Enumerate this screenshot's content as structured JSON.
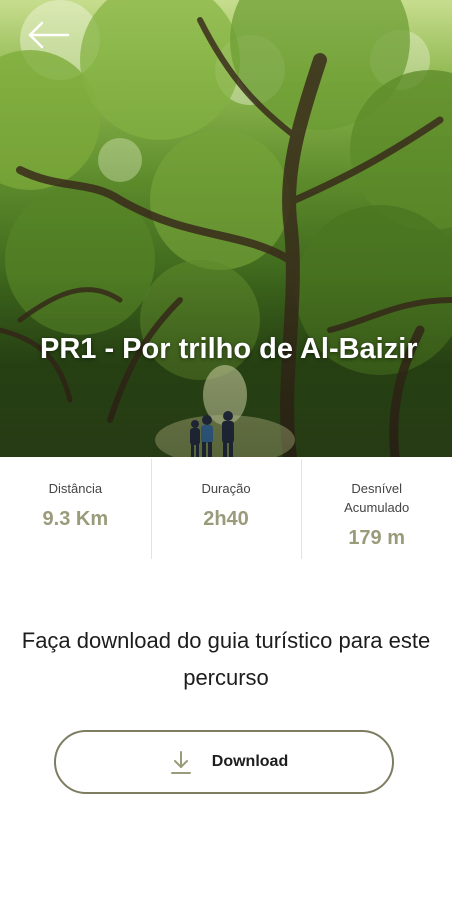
{
  "route": {
    "title": "PR1 - Por trilho de Al-Baizir"
  },
  "stats": [
    {
      "label": "Distância",
      "value": "9.3 Km"
    },
    {
      "label": "Duração",
      "value": "2h40"
    },
    {
      "label": "Desnível Acumulado",
      "value": "179 m"
    }
  ],
  "promo": {
    "text": "Faça download do guia turístico para este percurso"
  },
  "download": {
    "label": "Download",
    "icon": "download-icon"
  },
  "header": {
    "back_icon": "back-arrow-icon"
  },
  "colors": {
    "accent": "#9a9b7a",
    "button_border": "#7e7d62",
    "text": "#1d1d1d"
  }
}
